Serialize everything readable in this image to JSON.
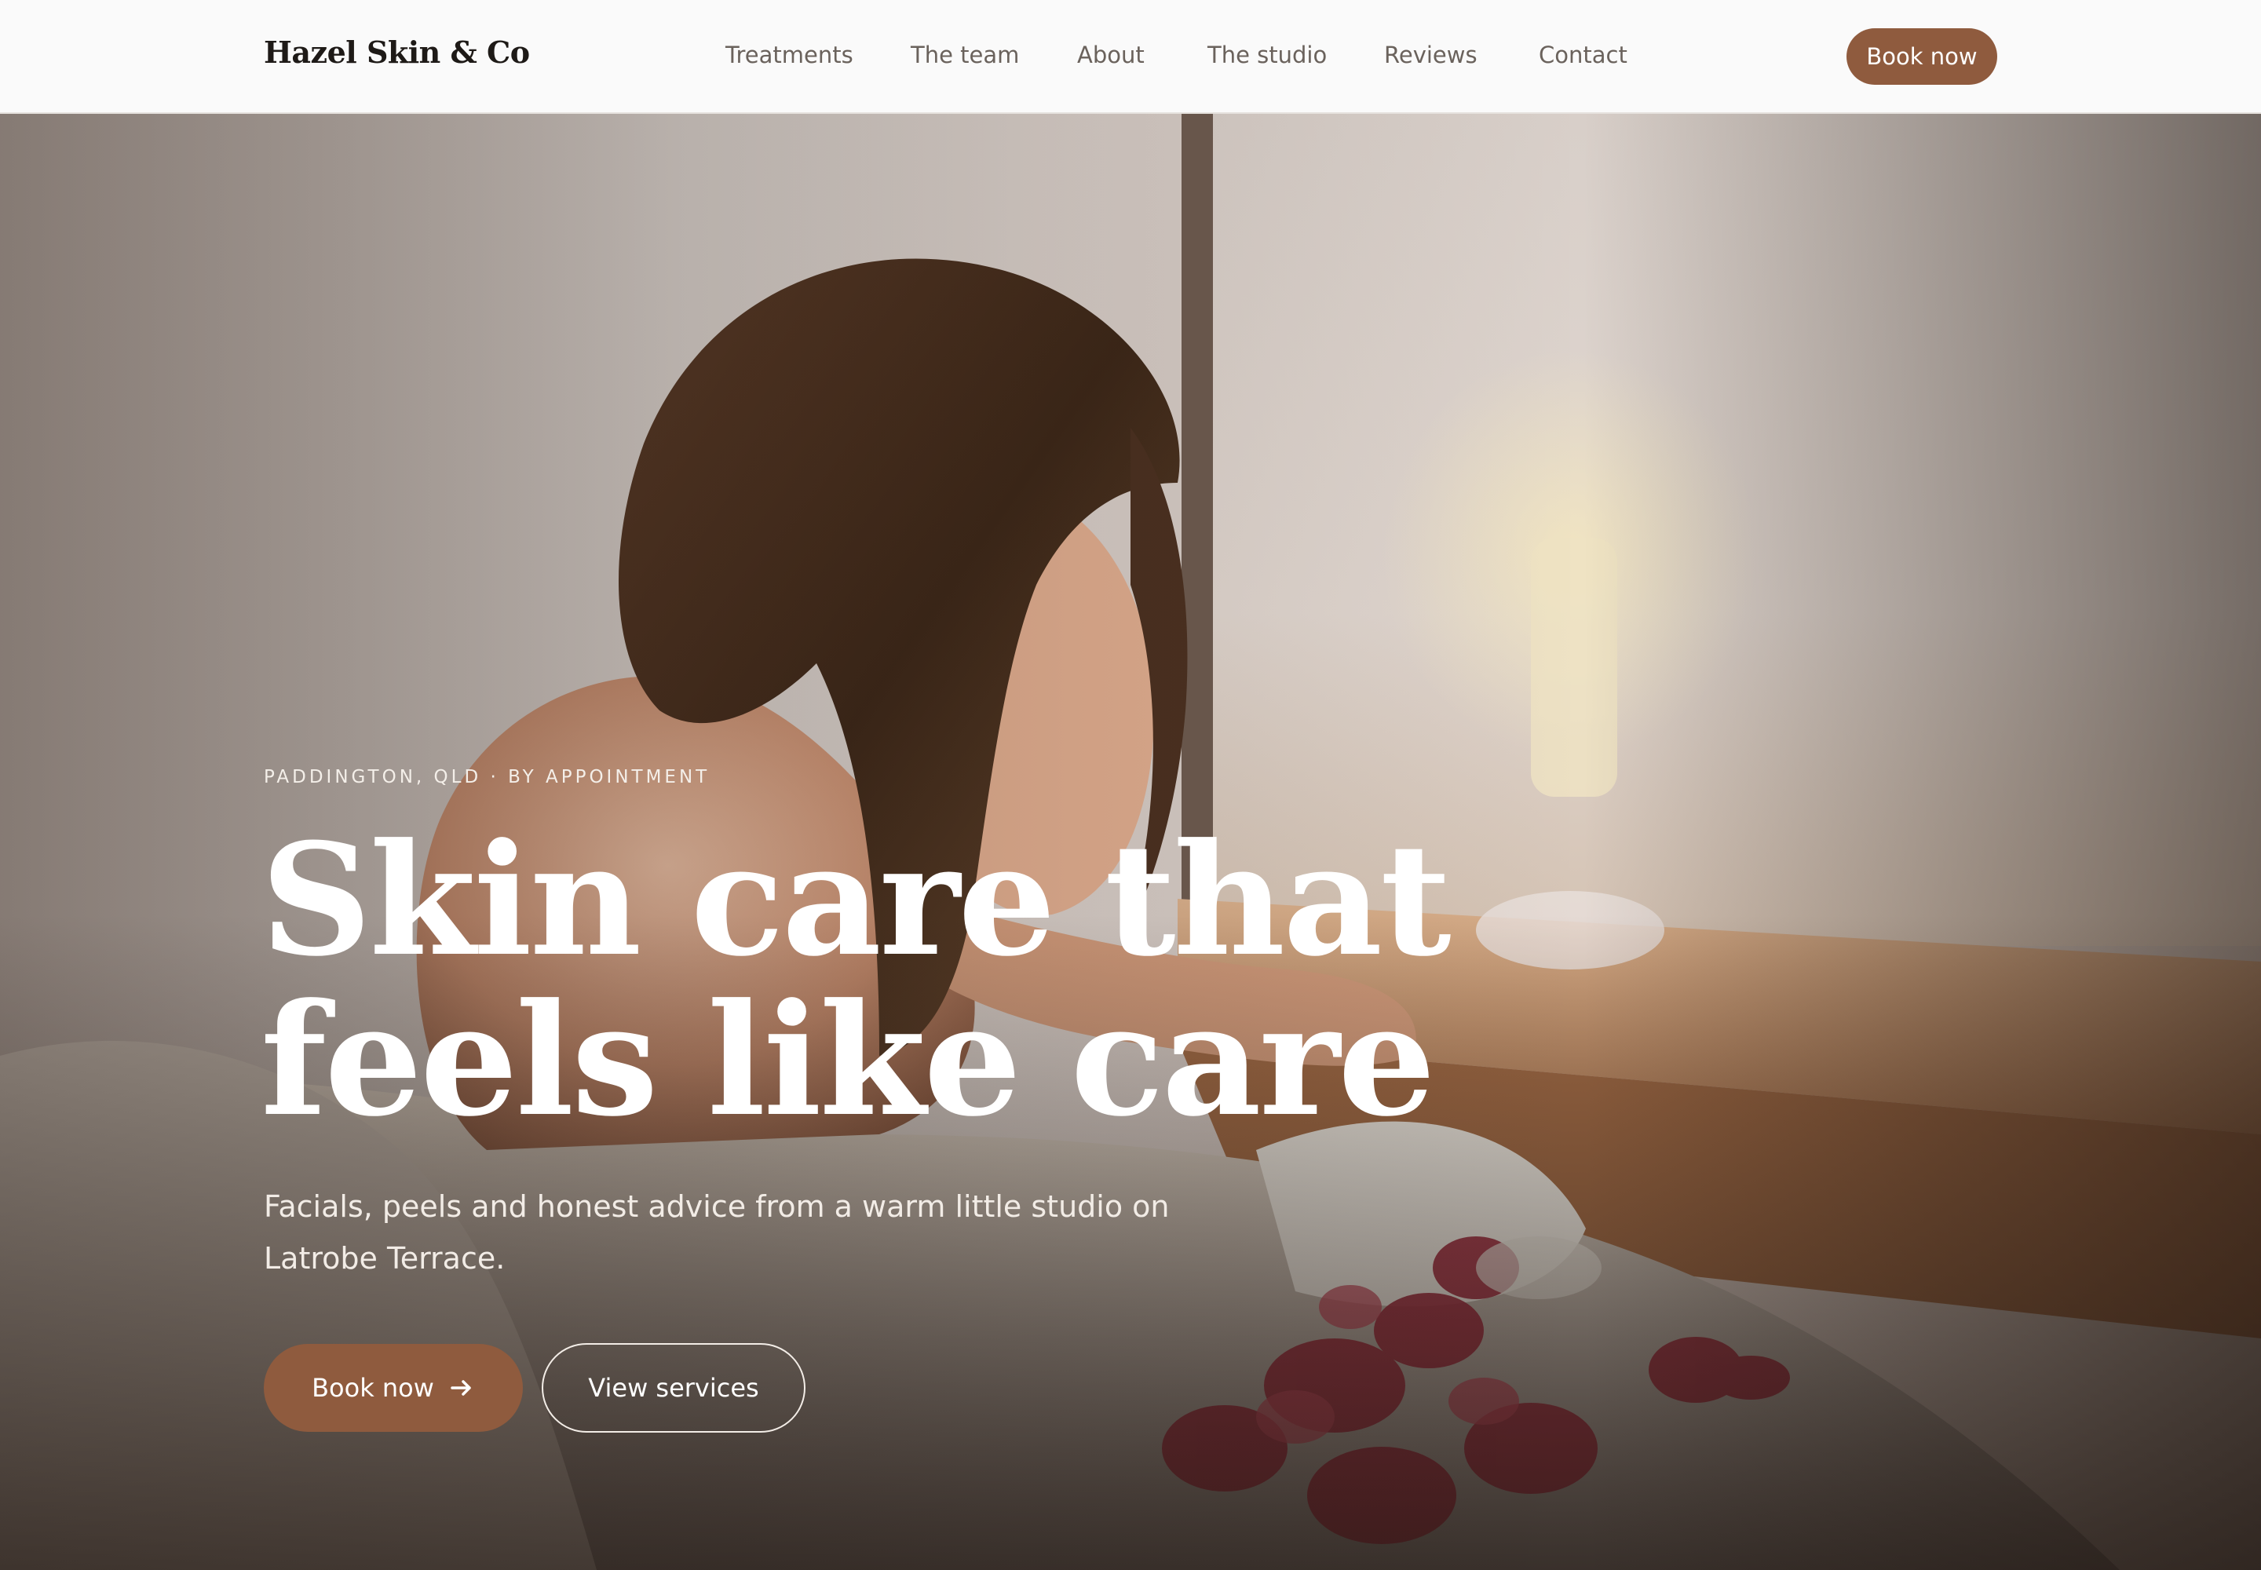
{
  "header": {
    "logo": "Hazel Skin & Co",
    "nav": [
      {
        "label": "Treatments"
      },
      {
        "label": "The team"
      },
      {
        "label": "About"
      },
      {
        "label": "The studio"
      },
      {
        "label": "Reviews"
      },
      {
        "label": "Contact"
      }
    ],
    "cta_label": "Book now"
  },
  "hero": {
    "eyebrow": "PADDINGTON, QLD · BY APPOINTMENT",
    "headline_line1": "Skin care that",
    "headline_line2": "feels like care",
    "subhead": "Facials, peels and honest advice from a warm little studio on Latrobe Terrace.",
    "primary_cta": "Book now",
    "primary_cta_icon": "arrow-right-icon",
    "secondary_cta": "View services"
  },
  "colors": {
    "accent": "#8f5b3e",
    "header_bg": "#fafafa",
    "logo_text": "#1e1a17",
    "nav_text": "#6a625c",
    "hero_text": "#ffffff"
  }
}
